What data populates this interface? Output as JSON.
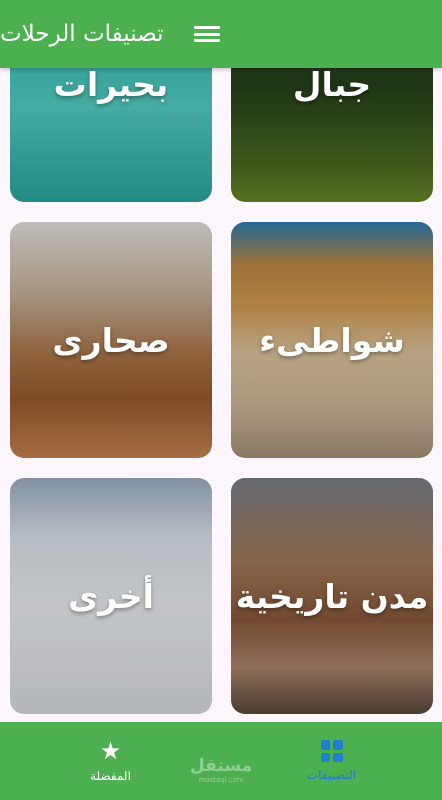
{
  "appbar": {
    "title": "تصنيفات الرحلات",
    "menu_icon": "menu-icon"
  },
  "categories": [
    {
      "label": "بحيرات"
    },
    {
      "label": "جبال"
    },
    {
      "label": "صحارى"
    },
    {
      "label": "شواطىء"
    },
    {
      "label": "أخرى"
    },
    {
      "label": "مدن تاريخية"
    }
  ],
  "bottom_nav": {
    "items": [
      {
        "label": "التصنيفات",
        "icon": "grid-icon",
        "active": true
      },
      {
        "label": "المفضلة",
        "icon": "star-icon",
        "active": false
      }
    ]
  },
  "watermark": {
    "main": "مستقل",
    "sub": "mostaql.com"
  },
  "colors": {
    "primary": "#4caf50",
    "active": "#1e7fd0",
    "background": "#fdf7fd"
  }
}
